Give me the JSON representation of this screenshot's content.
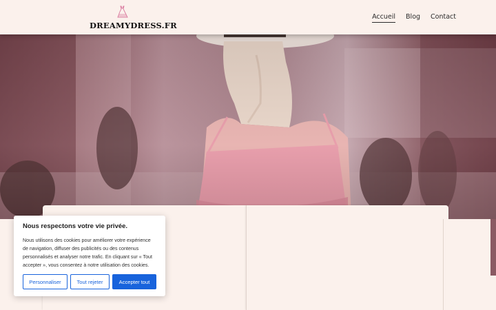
{
  "brand": {
    "name": "DREAMYDRESS.FR",
    "icon": "dress-icon",
    "icon_color": "#d9789d"
  },
  "nav": {
    "items": [
      "Accueil",
      "Blog",
      "Contact"
    ],
    "active": "Accueil"
  },
  "cookie_banner": {
    "title": "Nous respectons votre vie privée.",
    "text": "Nous utilisons des cookies pour améliorer votre expérience de navigation, diffuser des publicités ou des contenus personnalisés et analyser notre trafic. En cliquant sur « Tout accepter », vous consentez à notre utilisation des cookies.",
    "buttons": {
      "customize": "Personnaliser",
      "reject": "Tout rejeter",
      "accept": "Accepter tout"
    },
    "accent_color": "#1863dc"
  },
  "colors": {
    "background": "#fbf1ec",
    "hero_tint": "#b07a86"
  }
}
